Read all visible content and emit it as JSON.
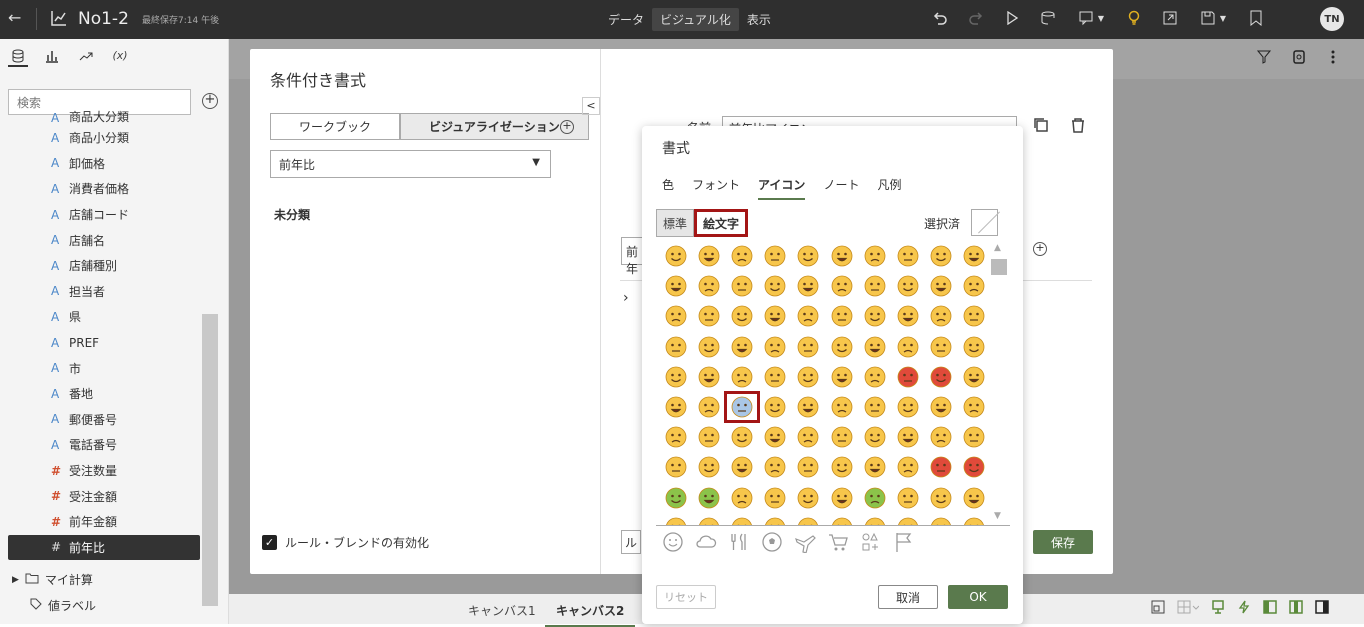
{
  "header": {
    "title": "No1-2",
    "saved": "最終保存7:14 午後",
    "tabs": [
      "データ",
      "ビジュアル化",
      "表示"
    ],
    "active_tab": 1,
    "avatar": "TN"
  },
  "sidebar": {
    "search_placeholder": "検索",
    "fields": [
      {
        "type": "A",
        "label": "商品大分類"
      },
      {
        "type": "A",
        "label": "商品小分類"
      },
      {
        "type": "A",
        "label": "卸価格"
      },
      {
        "type": "A",
        "label": "消費者価格"
      },
      {
        "type": "A",
        "label": "店舗コード"
      },
      {
        "type": "A",
        "label": "店舗名"
      },
      {
        "type": "A",
        "label": "店舗種別"
      },
      {
        "type": "A",
        "label": "担当者"
      },
      {
        "type": "A",
        "label": "県"
      },
      {
        "type": "A",
        "label": "PREF"
      },
      {
        "type": "A",
        "label": "市"
      },
      {
        "type": "A",
        "label": "番地"
      },
      {
        "type": "A",
        "label": "郵便番号"
      },
      {
        "type": "A",
        "label": "電話番号"
      },
      {
        "type": "#",
        "label": "受注数量"
      },
      {
        "type": "#",
        "label": "受注金額"
      },
      {
        "type": "#",
        "label": "前年金額"
      },
      {
        "type": "#",
        "label": "前年比"
      }
    ],
    "folders": [
      "マイ計算",
      "値ラベル"
    ]
  },
  "conditional_dialog": {
    "title": "条件付き書式",
    "segments": [
      "ワークブック",
      "ビジュアライゼーション"
    ],
    "field_select": "前年比",
    "category": "未分類",
    "name_label": "名前",
    "name_value": "前年比アイコン",
    "field2": "前年",
    "rule_button": "ル",
    "enable_label": "ルール・ブレンドの有効化",
    "save_label": "保存"
  },
  "format_dialog": {
    "title": "書式",
    "tabs": [
      "色",
      "フォント",
      "アイコン",
      "ノート",
      "凡例"
    ],
    "active_tab": 2,
    "segments": [
      "標準",
      "絵文字"
    ],
    "selected_label": "選択済",
    "reset_label": "リセット",
    "cancel_label": "取消",
    "ok_label": "OK",
    "category_icons": [
      "smiley-icon",
      "cloud-icon",
      "dining-icon",
      "soccer-ball-icon",
      "airplane-icon",
      "cart-icon",
      "symbols-icon",
      "flag-icon"
    ]
  },
  "canvas": {
    "tabs": [
      "キャンバス1",
      "キャンバス2"
    ],
    "active_tab": 1
  },
  "colors": {
    "accent_green": "#5a7a4d",
    "highlight_red": "#a31515",
    "emoji_yellow": "#f7c64b"
  }
}
